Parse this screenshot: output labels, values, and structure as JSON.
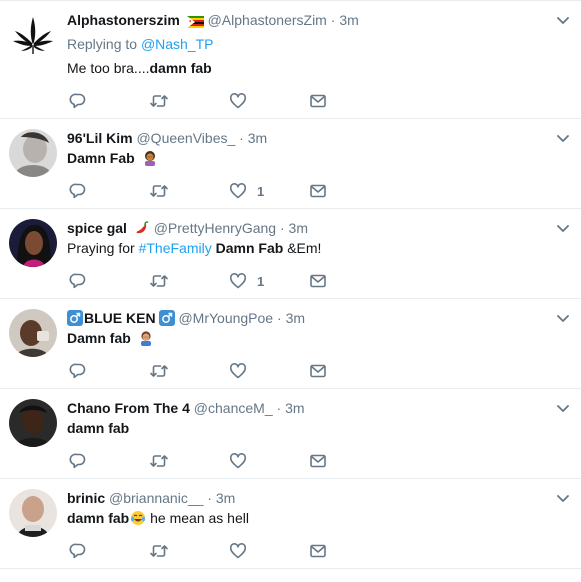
{
  "tweets": [
    {
      "name": "Alphastonerszim",
      "name_emoji": "zimbabwe-flag",
      "handle": "@AlphastonersZim",
      "dot": "·",
      "time": "3m",
      "replying_prefix": "Replying to",
      "replying_to": "@Nash_TP",
      "text_plain": "Me too bra....",
      "text_bold": "damn fab",
      "likes": ""
    },
    {
      "name": "96'Lil Kim",
      "handle": "@QueenVibes_",
      "dot": "·",
      "time": "3m",
      "text_bold": "Damn Fab",
      "text_emoji": "woman-facepalming-emoji",
      "likes": "1"
    },
    {
      "name": "spice gal",
      "name_emoji": "hot-pepper",
      "handle": "@PrettyHenryGang",
      "dot": "·",
      "time": "3m",
      "text_plain": "Praying for ",
      "hashtag": "#TheFamily",
      "text_bold": " Damn Fab",
      "text_after": " &Em!",
      "likes": "1"
    },
    {
      "name": "BLUE KEN",
      "name_emoji": "male-sign",
      "handle": "@MrYoungPoe",
      "dot": "·",
      "time": "3m",
      "text_bold": "Damn fab",
      "text_emoji": "man-facepalming-emoji",
      "likes": ""
    },
    {
      "name": "Chano From The 4",
      "handle": "@chanceM_",
      "dot": "·",
      "time": "3m",
      "text_bold": "damn fab",
      "likes": ""
    },
    {
      "name": "brinic",
      "handle": "@briannanic__",
      "dot": "·",
      "time": "3m",
      "text_bold": "damn fab",
      "text_emoji": "tears-of-joy-emoji",
      "text_after": " he mean as hell",
      "likes": ""
    }
  ],
  "colors": {
    "link": "#1da1f2",
    "secondary": "#657786",
    "icon": "#657786",
    "divider": "#e6ecf0"
  }
}
